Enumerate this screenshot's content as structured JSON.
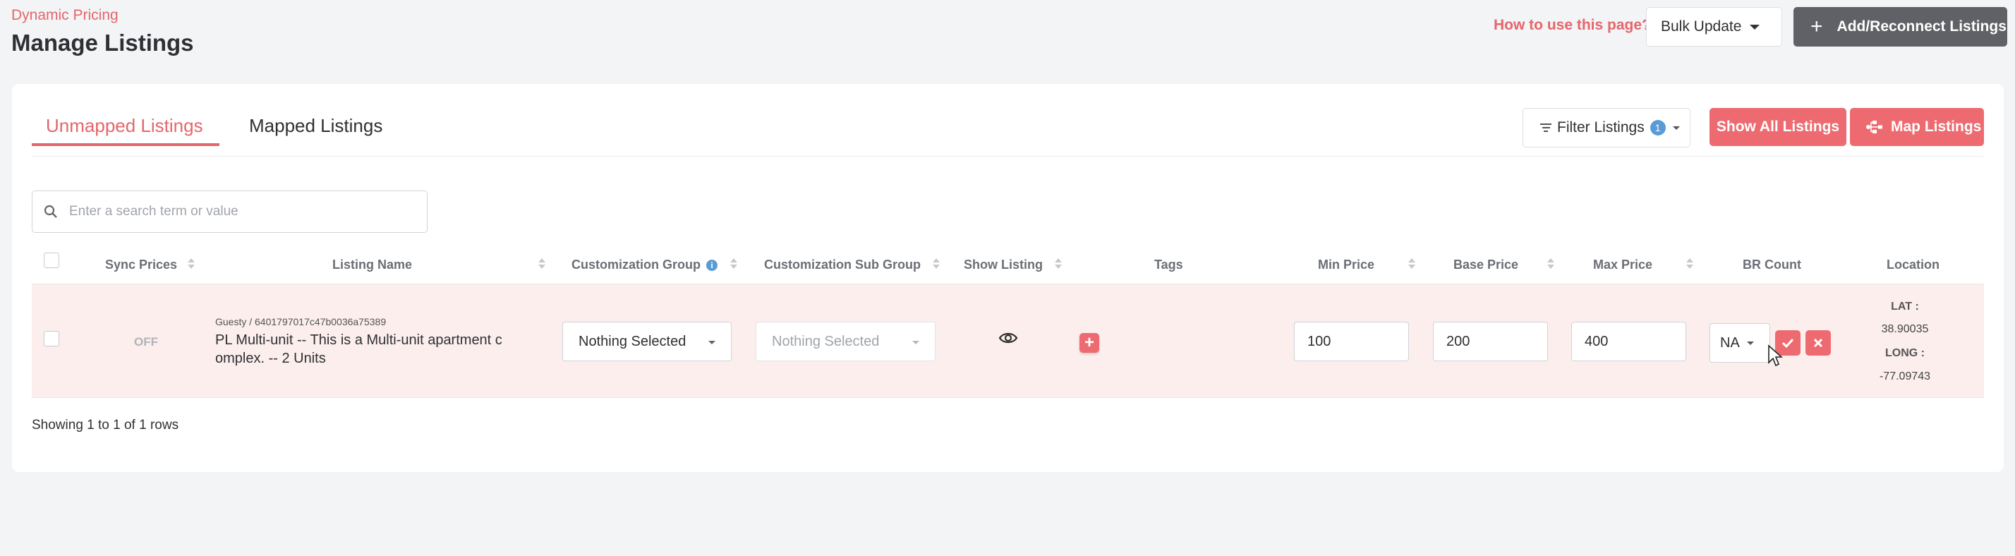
{
  "header": {
    "breadcrumb": "Dynamic Pricing",
    "title": "Manage Listings",
    "how_to_link": "How to use this page?",
    "bulk_update": "Bulk Update",
    "add_reconnect": "Add/Reconnect Listings"
  },
  "tabs": [
    {
      "label": "Unmapped Listings",
      "active": true
    },
    {
      "label": "Mapped Listings",
      "active": false
    }
  ],
  "toolbar": {
    "filter_label": "Filter Listings",
    "filter_count": "1",
    "show_all": "Show All Listings",
    "map_listings": "Map Listings"
  },
  "search": {
    "placeholder": "Enter a search term or value",
    "value": ""
  },
  "table": {
    "columns": {
      "sync_prices": "Sync Prices",
      "listing_name": "Listing Name",
      "customization_group": "Customization Group",
      "customization_sub_group": "Customization Sub Group",
      "show_listing": "Show Listing",
      "tags": "Tags",
      "min_price": "Min Price",
      "base_price": "Base Price",
      "max_price": "Max Price",
      "br_count": "BR Count",
      "location": "Location"
    },
    "rows": [
      {
        "sync": "OFF",
        "listing_sub": "Guesty / 6401797017c47b0036a75389",
        "listing_name": "PL Multi-unit -- This is a Multi-unit apartment c omplex. -- 2 Units",
        "customization_group": "Nothing Selected",
        "customization_sub_group": "Nothing Selected",
        "min_price": "100",
        "base_price": "200",
        "max_price": "400",
        "br_count": "NA",
        "lat_label": "LAT :",
        "lat": "38.90035",
        "long_label": "LONG :",
        "long": "-77.09743"
      }
    ]
  },
  "footer": {
    "rows_info": "Showing 1 to 1 of 1 rows"
  },
  "colors": {
    "accent": "#ed6b70",
    "dark_button": "#5f6166",
    "row_highlight": "#fbeeed",
    "info_blue": "#5b9bd5"
  },
  "icons": {
    "search": "search-icon",
    "filter": "filter-icon",
    "map": "map-tree-icon",
    "plus": "plus-icon",
    "eye": "eye-icon",
    "check": "check-icon",
    "close": "close-icon"
  }
}
